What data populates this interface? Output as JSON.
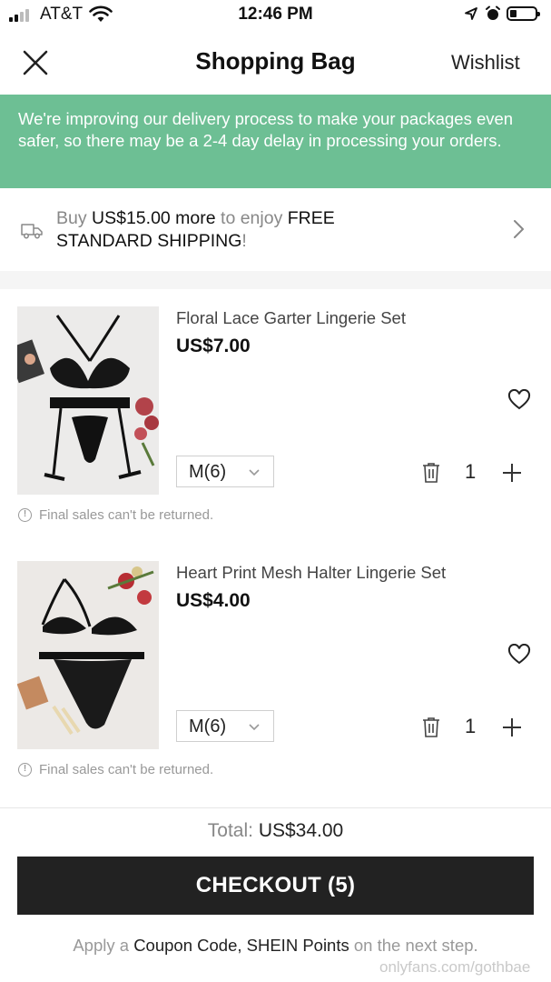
{
  "status_bar": {
    "carrier": "AT&T",
    "time": "12:46 PM"
  },
  "nav": {
    "title": "Shopping Bag",
    "wishlist": "Wishlist",
    "close_icon": "close-icon"
  },
  "banner": {
    "text": "We're improving our delivery process to make your packages even safer, so there may be a 2-4 day delay in processing your orders.",
    "color": "#6dbf94"
  },
  "shipping": {
    "part1": "Buy",
    "amount": "US$15.00 more",
    "part2": "to enjoy",
    "bold1": "FREE",
    "bold2": "STANDARD SHIPPING",
    "part3": "!"
  },
  "items": [
    {
      "name": "Floral Lace Garter Lingerie Set",
      "price": "US$7.00",
      "size": "M(6)",
      "quantity": "1",
      "note": "Final sales can't be returned."
    },
    {
      "name": "Heart Print Mesh Halter Lingerie Set",
      "price": "US$4.00",
      "size": "M(6)",
      "quantity": "1",
      "note": "Final sales can't be returned."
    }
  ],
  "total": {
    "label": "Total:",
    "amount": "US$34.00"
  },
  "checkout": {
    "label": "CHECKOUT (5)"
  },
  "hint": {
    "p1": "Apply a",
    "coupon": "Coupon Code, SHEIN Points",
    "p2": "on the next step."
  },
  "watermark": "onlyfans.com/gothbae"
}
